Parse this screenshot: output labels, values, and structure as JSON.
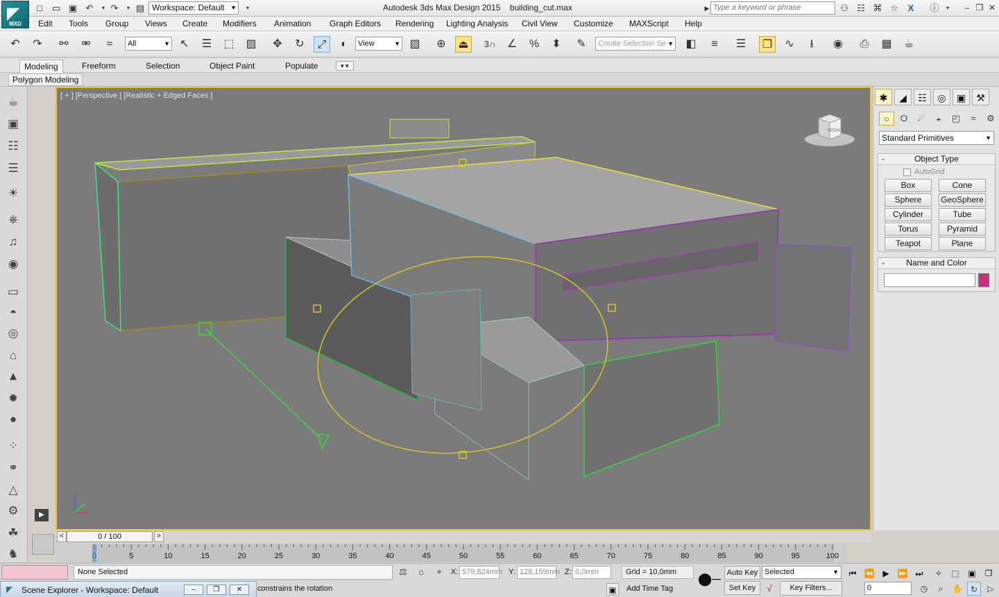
{
  "app": {
    "logo_label": "MXD",
    "title": "Autodesk 3ds Max Design 2015",
    "filename": "building_cut.max",
    "workspace": "Workspace: Default",
    "search_placeholder": "Type a keyword or phrase"
  },
  "menu": [
    "Edit",
    "Tools",
    "Group",
    "Views",
    "Create",
    "Modifiers",
    "Animation",
    "Graph Editors",
    "Rendering",
    "Lighting Analysis",
    "Civil View",
    "Customize",
    "MAXScript",
    "Help"
  ],
  "toolbar": {
    "selection_filter": "All",
    "reference_coord": "View",
    "snap_label": "3",
    "named_selection_placeholder": "Create Selection Se"
  },
  "ribbon": {
    "tabs": [
      "Modeling",
      "Freeform",
      "Selection",
      "Object Paint",
      "Populate"
    ],
    "active_tab": "Modeling",
    "panel_label": "Polygon Modeling"
  },
  "viewport": {
    "label": "[ + ] [Perspective ] [Realistic + Edged Faces ]",
    "viewcube_label": "RIGHT"
  },
  "command_panel": {
    "category": "Standard Primitives",
    "object_type_title": "Object Type",
    "autogrid_label": "AutoGrid",
    "primitives": [
      "Box",
      "Cone",
      "Sphere",
      "GeoSphere",
      "Cylinder",
      "Tube",
      "Torus",
      "Pyramid",
      "Teapot",
      "Plane"
    ],
    "name_color_title": "Name and Color",
    "rollout_toggle": "-",
    "swatch_color": "#c8327c"
  },
  "timeline": {
    "frame_display": "0 / 100",
    "prev": "<",
    "next": ">",
    "ticks": [
      "0",
      "5",
      "10",
      "15",
      "20",
      "25",
      "30",
      "35",
      "40",
      "45",
      "50",
      "55",
      "60",
      "65",
      "70",
      "75",
      "80",
      "85",
      "90",
      "95",
      "100"
    ]
  },
  "status": {
    "selection": "None Selected",
    "x_label": "X:",
    "x_value": "579,824mm",
    "y_label": "Y:",
    "y_value": "128,159mm",
    "z_label": "Z:",
    "z_value": "0,0mm",
    "grid": "Grid = 10,0mm",
    "auto_key": "Auto Key",
    "set_key": "Set Key",
    "key_mode": "Selected",
    "key_filters": "Key Filters...",
    "prompt": "constrains the rotation",
    "add_time_tag": "Add Time Tag",
    "current_frame": "0"
  },
  "scene_explorer": {
    "title": "Scene Explorer - Workspace: Default"
  }
}
